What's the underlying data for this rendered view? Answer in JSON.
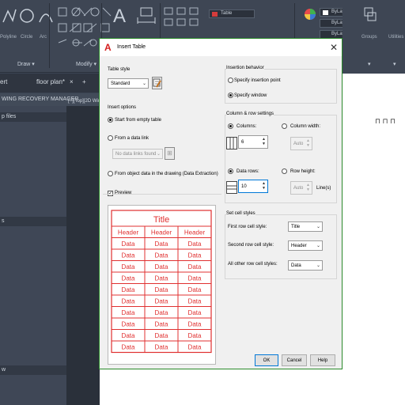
{
  "ribbon": {
    "icons": [
      {
        "name": "polyline-icon",
        "label": "Polyline"
      },
      {
        "name": "circle-icon",
        "label": "Circle"
      },
      {
        "name": "arc-icon",
        "label": "Arc"
      }
    ],
    "panels": {
      "draw": "Draw ▾",
      "modify": "Modify ▾",
      "groups": "Groups",
      "utilities": "Utilities"
    },
    "layer_boxes": [
      "Table",
      "ByLayer",
      "ByLayer",
      "ByLayer"
    ]
  },
  "tabs": {
    "left_tab": "ert",
    "active_tab": "floor plan*",
    "close": "×",
    "add": "+"
  },
  "recovery_label": "WING RECOVERY MANAGER",
  "left_panel": {
    "header1": "p files",
    "header2": "s",
    "header3": "w"
  },
  "viewport_label": "[−][Top][2D Wire",
  "dialog": {
    "title": "Insert Table",
    "close_icon": "close-icon",
    "table_style": {
      "group": "Table style",
      "value": "Standard"
    },
    "insert_options": {
      "group": "Insert options",
      "start_empty": "Start from empty table",
      "from_link": "From a data link",
      "no_links": "No data links found",
      "from_object": "From object data in the drawing (Data Extraction)",
      "selected": "start_empty"
    },
    "preview": {
      "label": "Preview",
      "checked": true,
      "title": "Title",
      "header": "Header",
      "data": "Data",
      "color": "#e03030"
    },
    "insertion": {
      "group": "Insertion behavior",
      "point": "Specify insertion point",
      "window": "Specify window",
      "selected": "window"
    },
    "col_row": {
      "group": "Column & row settings",
      "columns_label": "Columns:",
      "columns_value": "6",
      "column_width_label": "Column width:",
      "column_width_value": "Auto",
      "data_rows_label": "Data rows:",
      "data_rows_value": "10",
      "row_height_label": "Row height:",
      "row_height_value": "Auto",
      "row_height_unit": "Line(s)"
    },
    "cell_styles": {
      "group": "Set cell styles",
      "first_label": "First row cell style:",
      "first_value": "Title",
      "second_label": "Second row cell style:",
      "second_value": "Header",
      "other_label": "All other row cell styles:",
      "other_value": "Data"
    },
    "buttons": {
      "ok": "OK",
      "cancel": "Cancel",
      "help": "Help"
    }
  }
}
